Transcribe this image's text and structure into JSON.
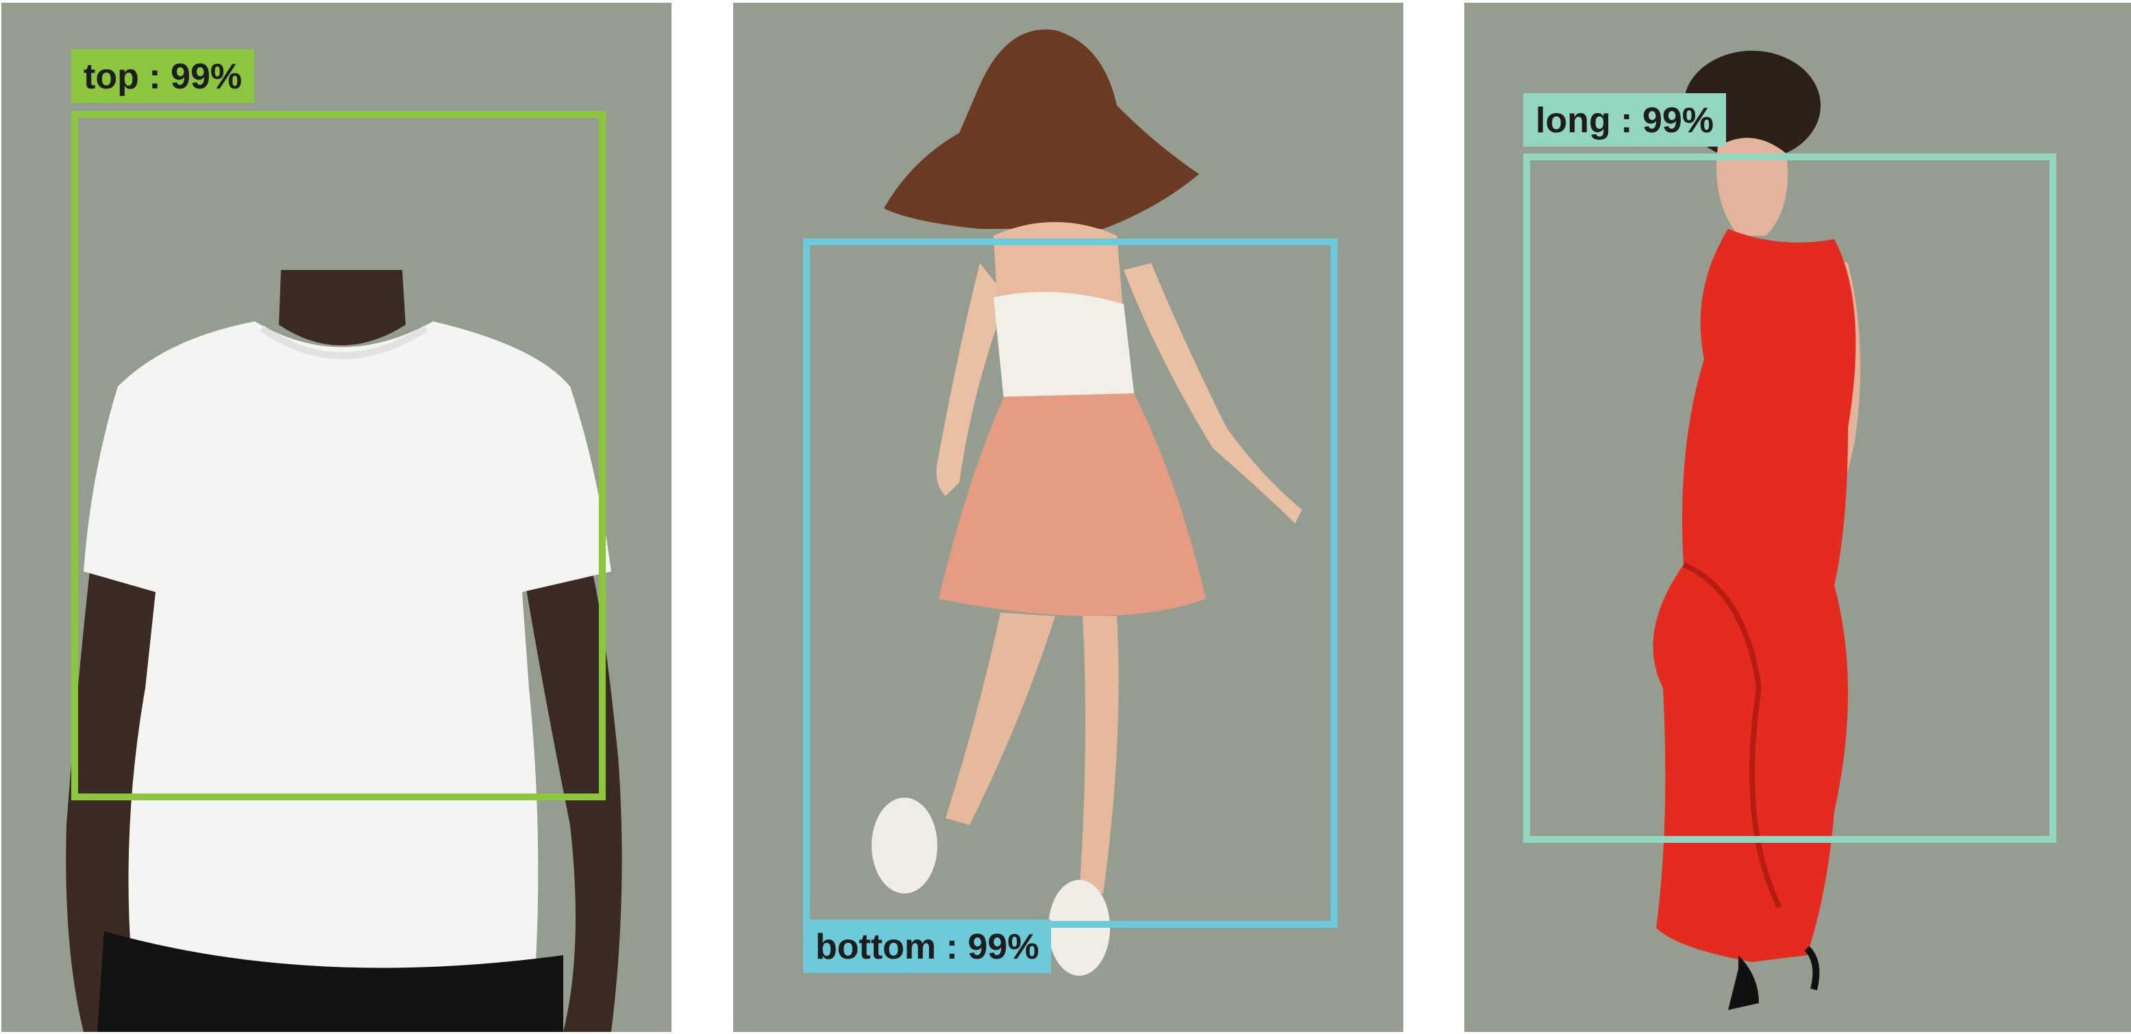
{
  "detections": [
    {
      "label": "top : 99%",
      "color": "#8cc63f"
    },
    {
      "label": "bottom : 99%",
      "color": "#6ccad9"
    },
    {
      "label": "long : 99%",
      "color": "#93d6c1"
    }
  ],
  "panel_background": "#949d8f",
  "figures": [
    "man in white t-shirt",
    "woman in white top and pink skirt",
    "woman in red long dress"
  ]
}
